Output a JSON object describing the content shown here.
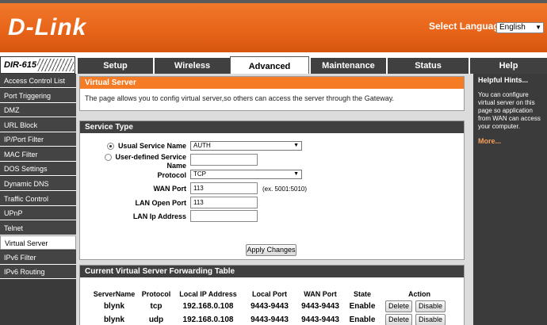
{
  "header": {
    "logo": "D-Link",
    "language_label": "Select Language",
    "language_value": "English"
  },
  "model": "DIR-615",
  "tabs": [
    {
      "label": "Setup",
      "active": false
    },
    {
      "label": "Wireless",
      "active": false
    },
    {
      "label": "Advanced",
      "active": true
    },
    {
      "label": "Maintenance",
      "active": false
    },
    {
      "label": "Status",
      "active": false
    },
    {
      "label": "Help",
      "active": false
    }
  ],
  "sidebar": {
    "items": [
      {
        "label": "Access Control List"
      },
      {
        "label": "Port Triggering"
      },
      {
        "label": "DMZ"
      },
      {
        "label": "URL Block"
      },
      {
        "label": "IP/Port Filter"
      },
      {
        "label": "MAC Filter"
      },
      {
        "label": "DOS Settings"
      },
      {
        "label": "Dynamic DNS"
      },
      {
        "label": "Traffic Control"
      },
      {
        "label": "UPnP"
      },
      {
        "label": "Telnet"
      },
      {
        "label": "Virtual Server",
        "active": true
      },
      {
        "label": "IPv6 Filter"
      },
      {
        "label": "IPv6 Routing"
      }
    ]
  },
  "virtual_server": {
    "title": "Virtual Server",
    "description": "The page allows you to config virtual server,so others can access the server through the Gateway."
  },
  "service_type": {
    "title": "Service Type",
    "usual_label": "Usual Service Name",
    "usual_value": "AUTH",
    "user_defined_label": "User-defined Service Name",
    "user_defined_value": "",
    "protocol_label": "Protocol",
    "protocol_value": "TCP",
    "wan_port_label": "WAN Port",
    "wan_port_value": "113",
    "wan_port_hint": "(ex. 5001:5010)",
    "lan_open_port_label": "LAN Open Port",
    "lan_open_port_value": "113",
    "lan_ip_label": "LAN Ip Address",
    "lan_ip_value": "",
    "apply_label": "Apply Changes"
  },
  "forwarding_table": {
    "title": "Current Virtual Server Forwarding Table",
    "columns": [
      "ServerName",
      "Protocol",
      "Local IP Address",
      "Local Port",
      "WAN Port",
      "State",
      "Action"
    ],
    "rows": [
      {
        "server": "blynk",
        "protocol": "tcp",
        "local_ip": "192.168.0.108",
        "local_port": "9443-9443",
        "wan_port": "9443-9443",
        "state": "Enable",
        "delete": "Delete",
        "disable": "Disable"
      },
      {
        "server": "blynk",
        "protocol": "udp",
        "local_ip": "192.168.0.108",
        "local_port": "9443-9443",
        "wan_port": "9443-9443",
        "state": "Enable",
        "delete": "Delete",
        "disable": "Disable"
      }
    ]
  },
  "hints": {
    "title": "Helpful Hints...",
    "text": "You can configure virtual server on this page so application from WAN can access your computer.",
    "more": "More..."
  },
  "colors": {
    "accent_orange": "#f57b24",
    "dark_gray": "#404040"
  }
}
